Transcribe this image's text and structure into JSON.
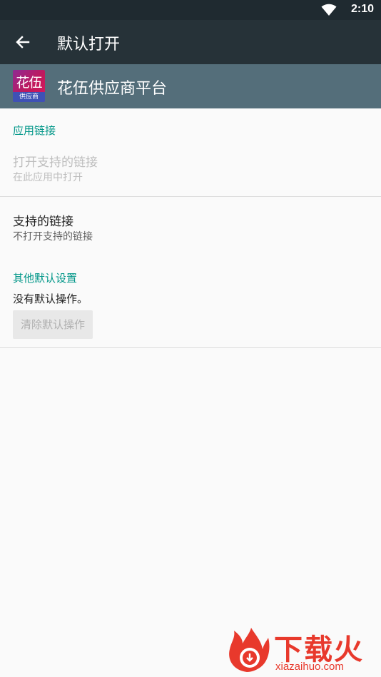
{
  "status_bar": {
    "time": "2:10",
    "icons": [
      "wifi-icon"
    ]
  },
  "app_bar": {
    "title": "默认打开",
    "back_icon": "arrow-left-icon"
  },
  "app_header": {
    "icon_text_top": "花伍",
    "icon_text_bottom": "供应商",
    "app_name": "花伍供应商平台"
  },
  "app_links": {
    "header": "应用链接",
    "open_supported": {
      "title": "打开支持的链接",
      "summary": "在此应用中打开"
    },
    "supported_links": {
      "title": "支持的链接",
      "summary": "不打开支持的链接"
    }
  },
  "other_defaults": {
    "header": "其他默认设置",
    "status": "没有默认操作。",
    "clear_button": "清除默认操作"
  },
  "watermark": {
    "brand": "下载火",
    "url": "xiazaihuo.com"
  },
  "colors": {
    "status_bar": "#1f2a30",
    "app_bar": "#263238",
    "app_header": "#546e7a",
    "accent": "#009688",
    "background": "#fafafa",
    "watermark": "#e8392c"
  }
}
